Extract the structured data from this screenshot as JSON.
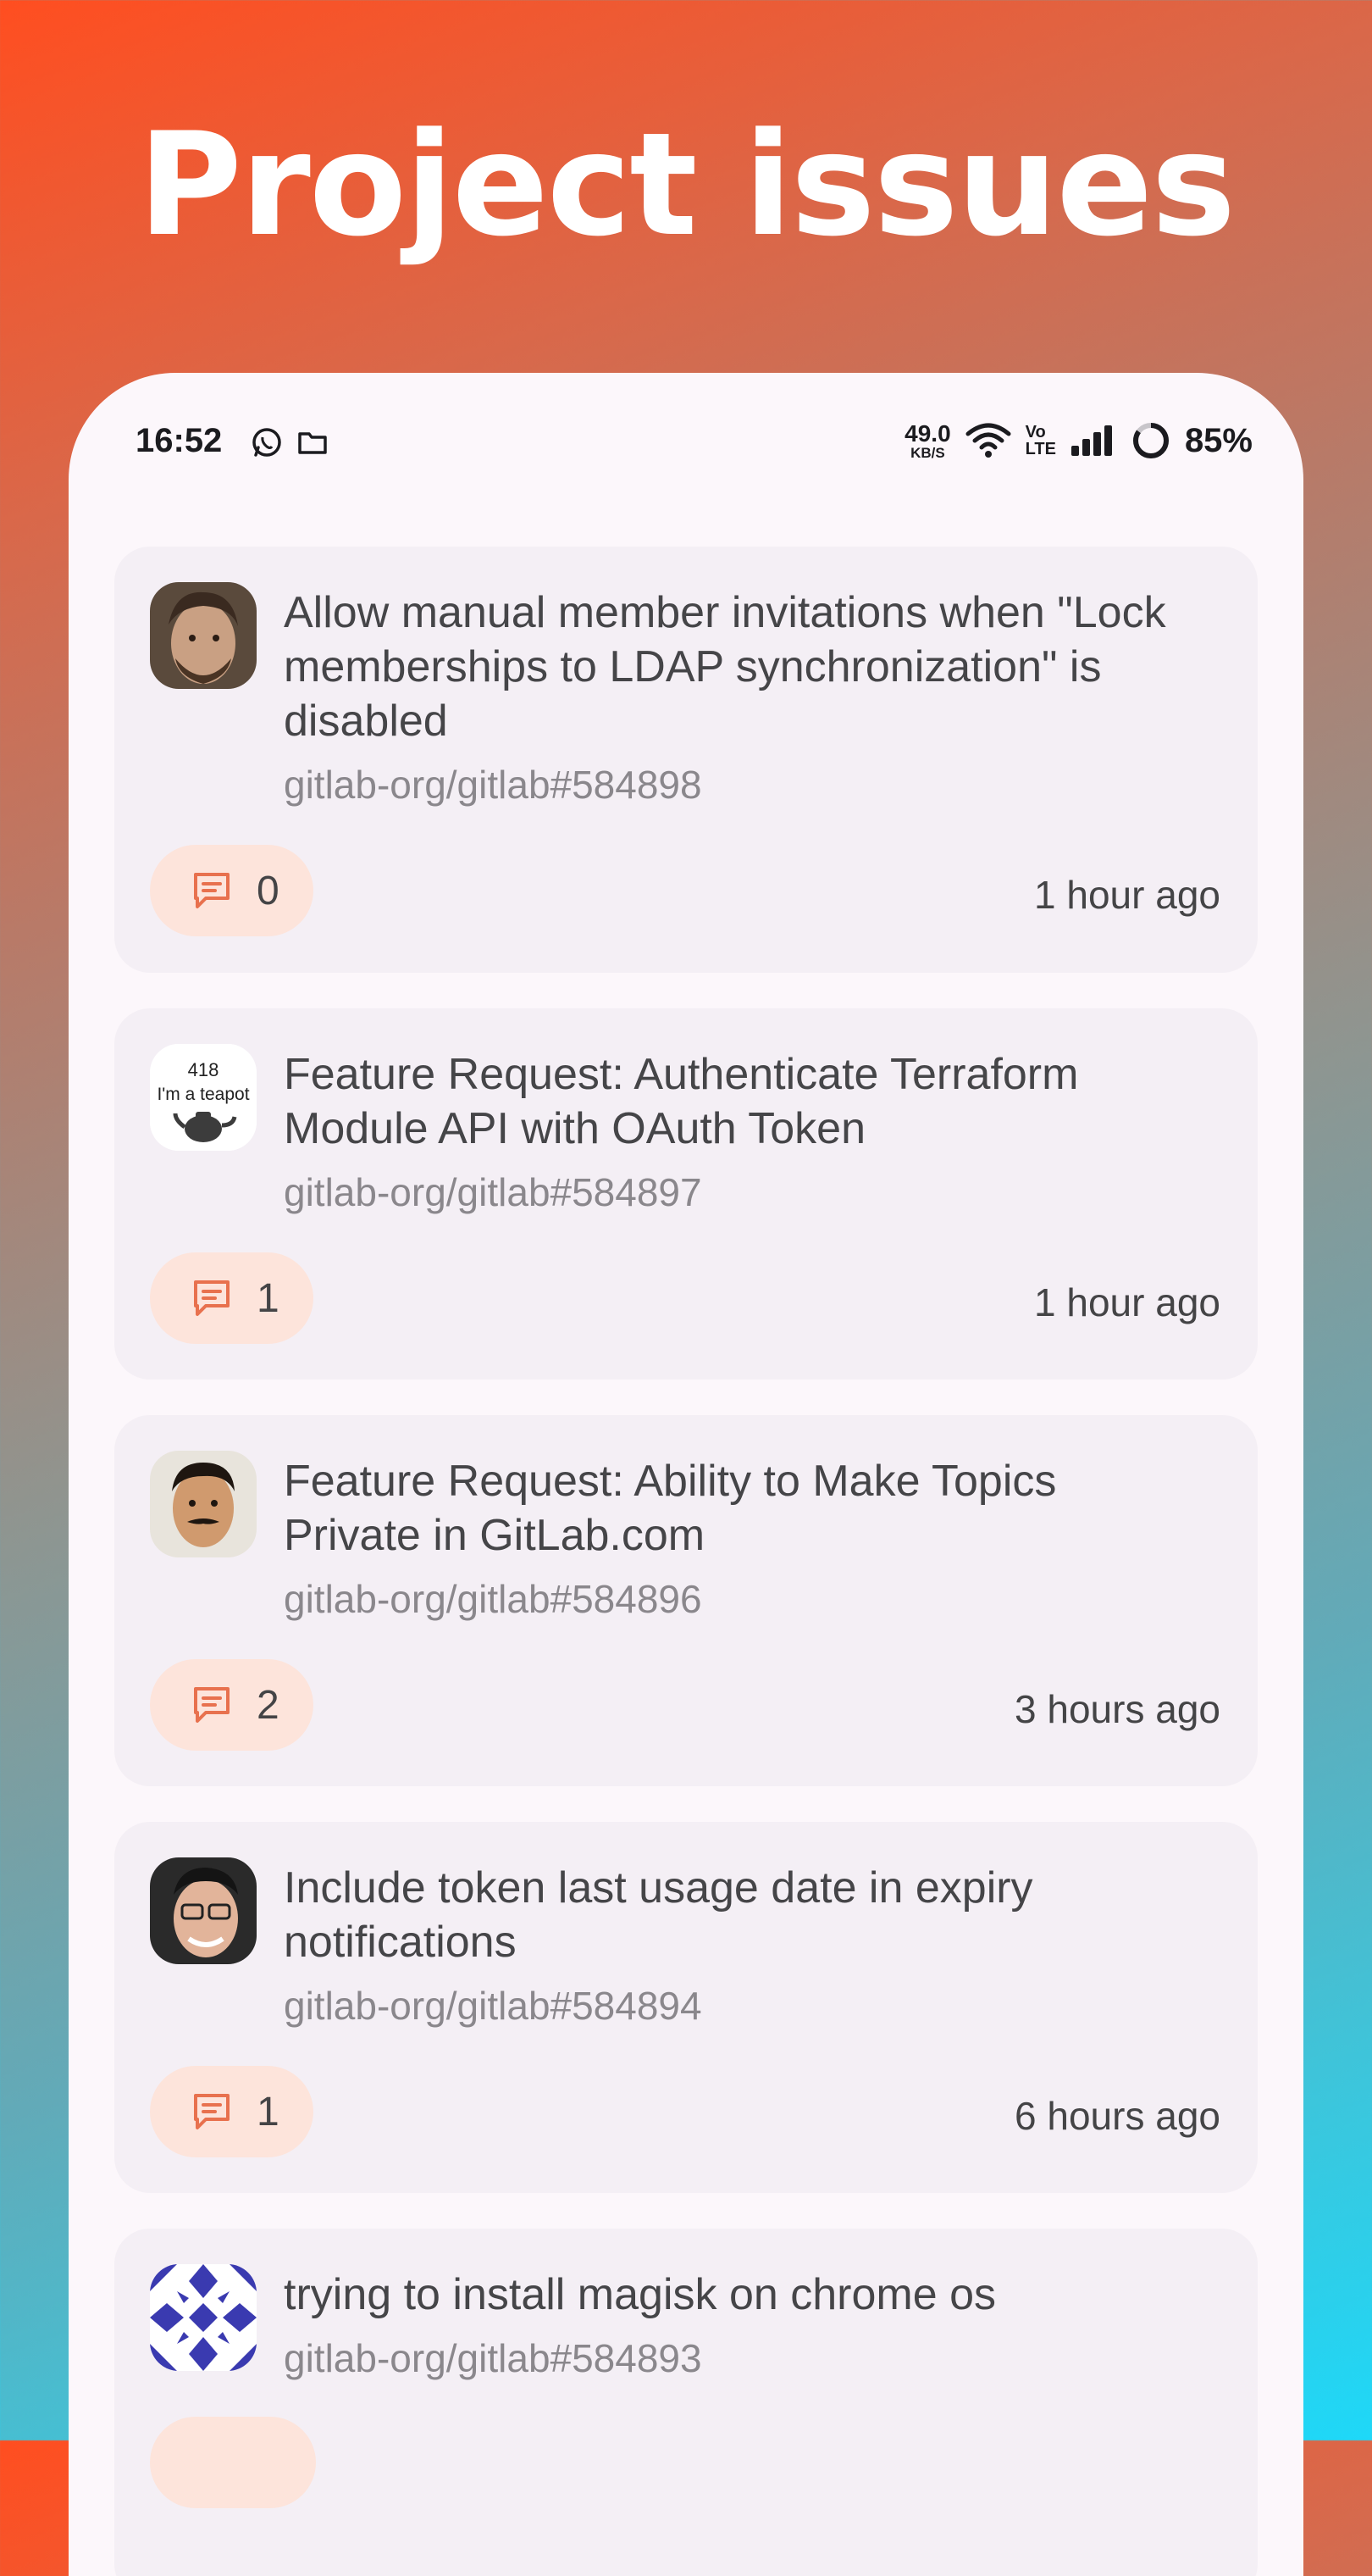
{
  "hero": {
    "title": "Project issues"
  },
  "status_bar": {
    "time": "16:52",
    "left_icons": [
      "whatsapp-icon",
      "folder-icon"
    ],
    "net_speed": "49.0",
    "net_speed_unit": "KB/S",
    "volte_top": "Vo",
    "volte_bottom": "LTE",
    "battery": "85%"
  },
  "colors": {
    "accent": "#e8714e",
    "pill_bg": "#fde4db",
    "card_bg": "#f4eff5"
  },
  "issues": [
    {
      "title": "Allow manual member invitations when \"Lock memberships to LDAP synchronization\" is disabled",
      "ref": "gitlab-org/gitlab#584898",
      "comments": "0",
      "time": "1 hour ago",
      "avatar": "photo-avatar-bearded"
    },
    {
      "title": "Feature Request: Authenticate Terraform Module API with OAuth Token",
      "ref": "gitlab-org/gitlab#584897",
      "comments": "1",
      "time": "1 hour ago",
      "avatar": "teapot-avatar",
      "avatar_text_top": "418",
      "avatar_text_bottom": "I'm a teapot"
    },
    {
      "title": "Feature Request: Ability to Make Topics Private in GitLab.com",
      "ref": "gitlab-org/gitlab#584896",
      "comments": "2",
      "time": "3 hours ago",
      "avatar": "photo-avatar-mustache"
    },
    {
      "title": "Include token last usage date in expiry notifications",
      "ref": "gitlab-org/gitlab#584894",
      "comments": "1",
      "time": "6 hours ago",
      "avatar": "photo-avatar-glasses"
    },
    {
      "title": "trying to install magisk on chrome os",
      "ref": "gitlab-org/gitlab#584893",
      "comments": "",
      "time": "",
      "avatar": "identicon-avatar"
    }
  ]
}
